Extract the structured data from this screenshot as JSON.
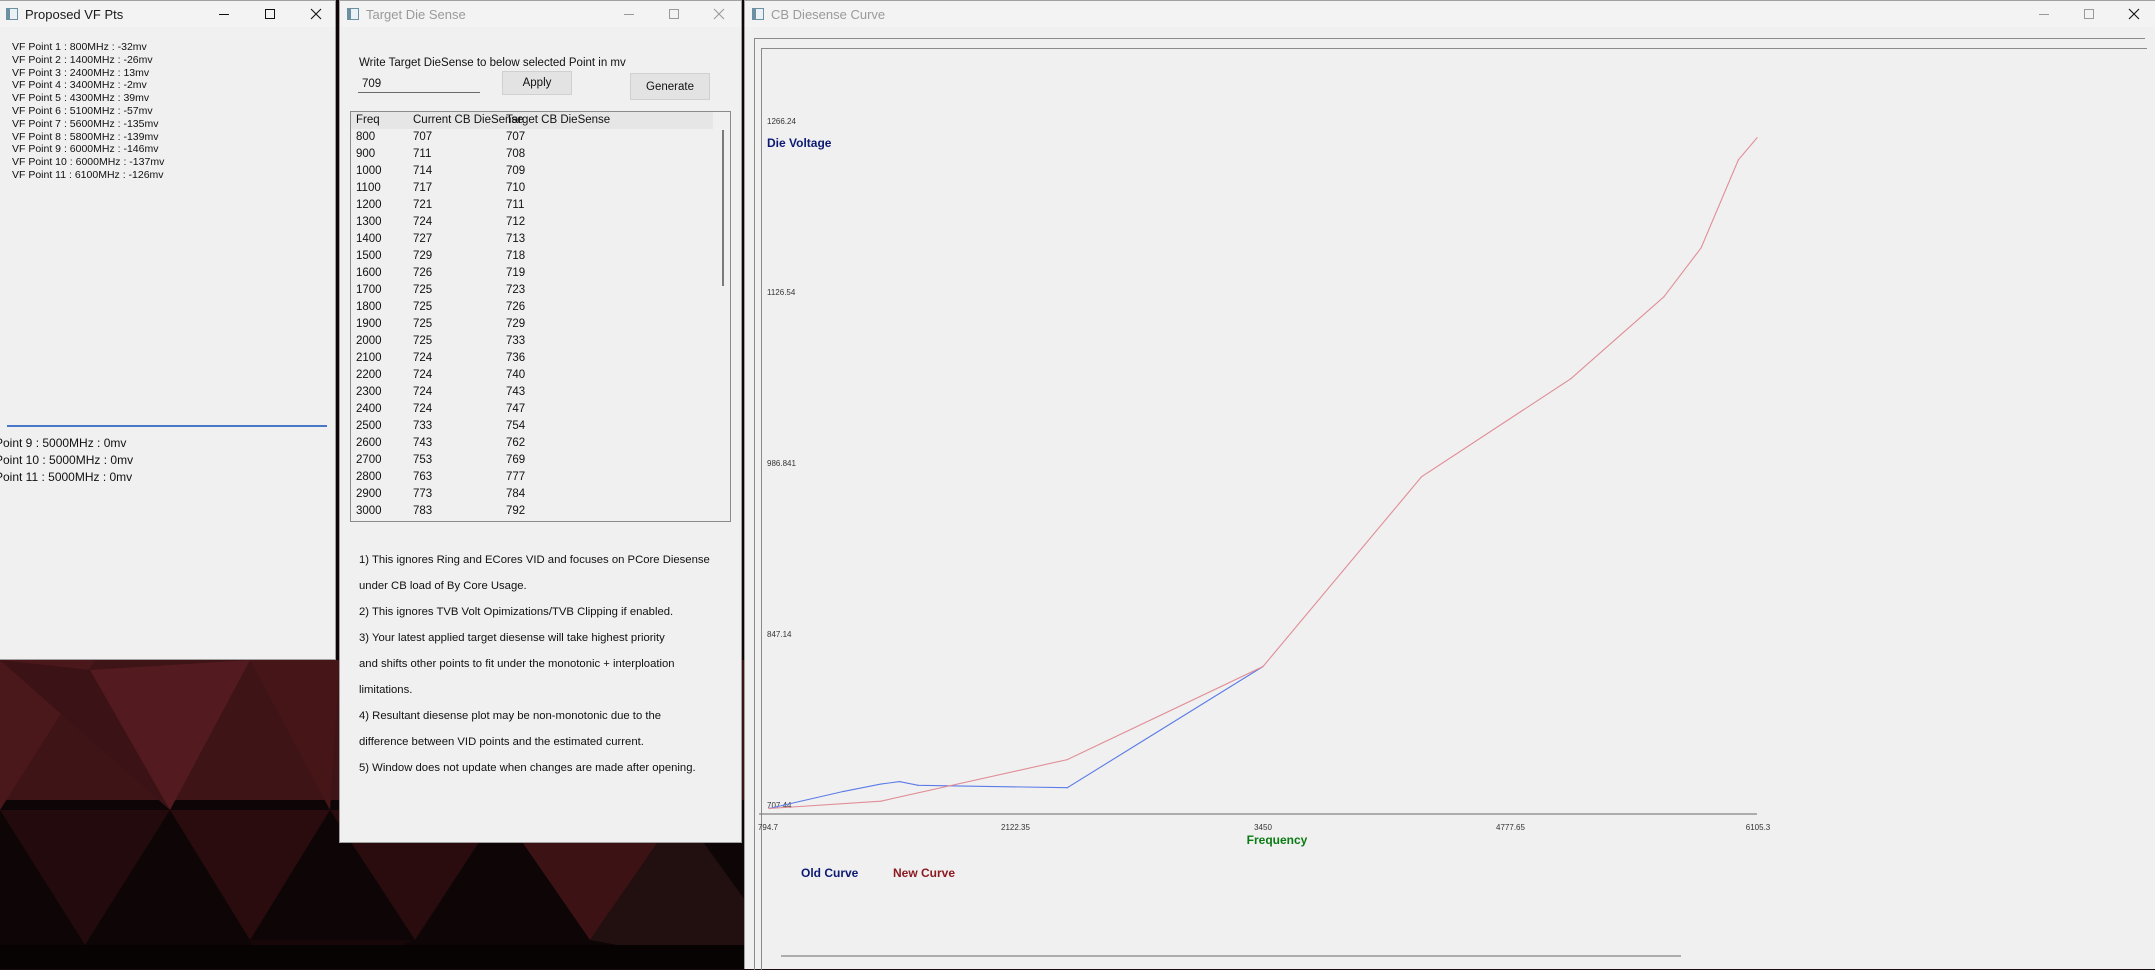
{
  "colors": {
    "old_curve": "#5b7be8",
    "new_curve": "#e08d96",
    "die_voltage_label": "#0d1a73",
    "frequency_label": "#0a7a12",
    "new_curve_legend": "#8a1c22"
  },
  "vf_window": {
    "title": "Proposed VF Pts",
    "points": [
      "VF Point 1 : 800MHz : -32mv",
      "VF Point 2 : 1400MHz : -26mv",
      "VF Point 3 : 2400MHz : 13mv",
      "VF Point 4 : 3400MHz : -2mv",
      "VF Point 5 : 4300MHz : 39mv",
      "VF Point 6 : 5100MHz : -57mv",
      "VF Point 7 : 5600MHz : -135mv",
      "VF Point 8 : 5800MHz : -139mv",
      "VF Point 9 : 6000MHz : -146mv",
      "VF Point 10 : 6000MHz : -137mv",
      "VF Point 11 : 6100MHz : -126mv"
    ],
    "overflow_points": [
      "Point 9 : 5000MHz : 0mv",
      "Point 10 : 5000MHz : 0mv",
      "Point 11 : 5000MHz : 0mv"
    ]
  },
  "target_window": {
    "title": "Target Die Sense",
    "instruction": "Write Target DieSense to below selected Point in mv",
    "input_value": "709",
    "apply_label": "Apply",
    "generate_label": "Generate",
    "columns": [
      "Freq",
      "Current CB DieSense",
      "Target CB DieSense"
    ],
    "rows": [
      [
        "800",
        "707",
        "707"
      ],
      [
        "900",
        "711",
        "708"
      ],
      [
        "1000",
        "714",
        "709"
      ],
      [
        "1100",
        "717",
        "710"
      ],
      [
        "1200",
        "721",
        "711"
      ],
      [
        "1300",
        "724",
        "712"
      ],
      [
        "1400",
        "727",
        "713"
      ],
      [
        "1500",
        "729",
        "718"
      ],
      [
        "1600",
        "726",
        "719"
      ],
      [
        "1700",
        "725",
        "723"
      ],
      [
        "1800",
        "725",
        "726"
      ],
      [
        "1900",
        "725",
        "729"
      ],
      [
        "2000",
        "725",
        "733"
      ],
      [
        "2100",
        "724",
        "736"
      ],
      [
        "2200",
        "724",
        "740"
      ],
      [
        "2300",
        "724",
        "743"
      ],
      [
        "2400",
        "724",
        "747"
      ],
      [
        "2500",
        "733",
        "754"
      ],
      [
        "2600",
        "743",
        "762"
      ],
      [
        "2700",
        "753",
        "769"
      ],
      [
        "2800",
        "763",
        "777"
      ],
      [
        "2900",
        "773",
        "784"
      ],
      [
        "3000",
        "783",
        "792"
      ]
    ],
    "notes": [
      "1) This ignores Ring and ECores VID and focuses on PCore Diesense",
      "under CB load of By Core Usage.",
      "2) This ignores TVB Volt Opimizations/TVB Clipping if enabled.",
      "3) Your latest applied target diesense will take highest priority",
      "and shifts other points to fit under the monotonic + interploation",
      "limitations.",
      "4) Resultant diesense plot may be non-monotonic due to the",
      "difference between VID points and the estimated current.",
      "5) Window does not update when changes are made after opening."
    ]
  },
  "curve_window": {
    "title": "CB Diesense Curve"
  },
  "chart_data": {
    "type": "line",
    "title": "",
    "xlabel": "Frequency",
    "ylabel": "Die Voltage",
    "x_ticks": [
      "794.7",
      "2122.35",
      "3450",
      "4777.65",
      "6105.3"
    ],
    "y_ticks": [
      "707.44",
      "847.14",
      "986.841",
      "1126.54",
      "1266.24"
    ],
    "xlim": [
      794.7,
      6105.3
    ],
    "ylim": [
      707.44,
      1266.24
    ],
    "grid": false,
    "legend_position": "bottom-left",
    "series": [
      {
        "name": "Old Curve",
        "points": [
          [
            800,
            707
          ],
          [
            1200,
            721
          ],
          [
            1400,
            727
          ],
          [
            1500,
            729
          ],
          [
            1600,
            726
          ],
          [
            2400,
            724
          ],
          [
            3450,
            823
          ]
        ]
      },
      {
        "name": "New Curve",
        "points": [
          [
            800,
            707
          ],
          [
            1400,
            713
          ],
          [
            2400,
            747
          ],
          [
            3450,
            823
          ],
          [
            4300,
            978
          ],
          [
            5100,
            1058
          ],
          [
            5600,
            1125
          ],
          [
            5800,
            1165
          ],
          [
            6000,
            1237
          ],
          [
            6100,
            1255
          ]
        ]
      }
    ]
  }
}
